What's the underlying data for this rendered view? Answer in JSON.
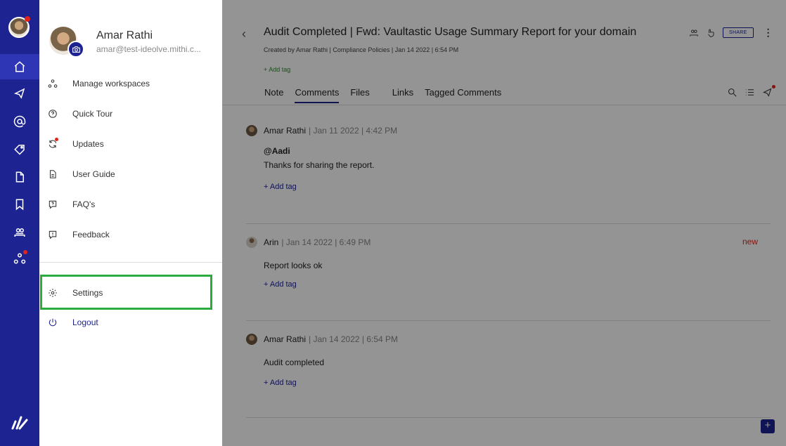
{
  "profile": {
    "name": "Amar Rathi",
    "email": "amar@test-ideolve.mithi.c..."
  },
  "menu": [
    {
      "label": "Manage workspaces",
      "icon": "workspaces-icon"
    },
    {
      "label": "Quick Tour",
      "icon": "help-circle-icon"
    },
    {
      "label": "Updates",
      "icon": "refresh-icon"
    },
    {
      "label": "User Guide",
      "icon": "document-icon"
    },
    {
      "label": "FAQ's",
      "icon": "faq-icon"
    },
    {
      "label": "Feedback",
      "icon": "feedback-icon"
    }
  ],
  "settings_label": "Settings",
  "logout_label": "Logout",
  "header": {
    "title": "Audit Completed | Fwd: Vaultastic Usage Summary Report for your domain",
    "meta": "Created by  Amar Rathi  |  Compliance Policies  |  Jan 14 2022 | 6:54 PM",
    "add_tag": "+ Add tag",
    "share_label": "SHARE"
  },
  "tabs": [
    "Note",
    "Comments",
    "Files",
    "Links",
    "Tagged Comments"
  ],
  "active_tab": "Comments",
  "comments": [
    {
      "author": "Amar Rathi",
      "meta": "| Jan 11 2022 | 4:42 PM",
      "mention": "@Aadi",
      "text": "Thanks for sharing the report.",
      "add_tag": "+ Add tag",
      "badge": ""
    },
    {
      "author": "Arin",
      "meta": "| Jan 14 2022 | 6:49 PM",
      "mention": "",
      "text": "Report looks ok",
      "add_tag": "+ Add tag",
      "badge": "new"
    },
    {
      "author": "Amar Rathi",
      "meta": "| Jan 14 2022 | 6:54 PM",
      "mention": "",
      "text": "Audit completed",
      "add_tag": "+ Add tag",
      "badge": ""
    }
  ],
  "fab_label": "+",
  "colors": {
    "accent": "#1d2491",
    "highlight": "#2bab3f",
    "alert": "#e0241b"
  }
}
